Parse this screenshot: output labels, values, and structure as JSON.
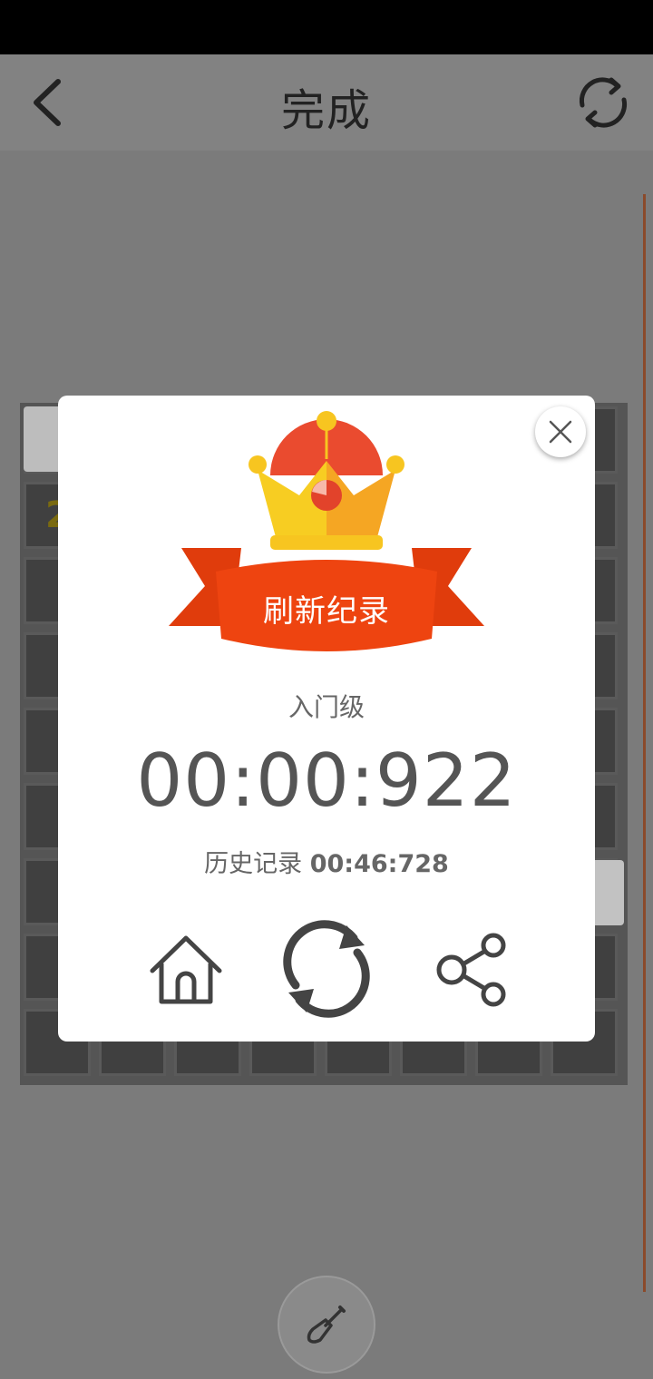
{
  "header": {
    "title": "完成",
    "back_icon": "chevron-left-icon",
    "refresh_icon": "refresh-icon"
  },
  "board": {
    "visible_number": "2"
  },
  "dialog": {
    "badge_text": "刷新纪录",
    "level": "入门级",
    "time": "00:00:922",
    "history_label": "历史记录",
    "history_value": "00:46:728",
    "buttons": {
      "home_icon": "home-icon",
      "restart_icon": "restart-icon",
      "share_icon": "share-icon",
      "close_icon": "close-icon"
    }
  },
  "tools": {
    "dig_icon": "shovel-icon"
  },
  "colors": {
    "ribbon": "#ee4410",
    "ribbon_dark": "#c8350c",
    "crown_gold": "#f7c520",
    "crown_orange": "#f5a623",
    "crown_red": "#ea4b2f"
  }
}
